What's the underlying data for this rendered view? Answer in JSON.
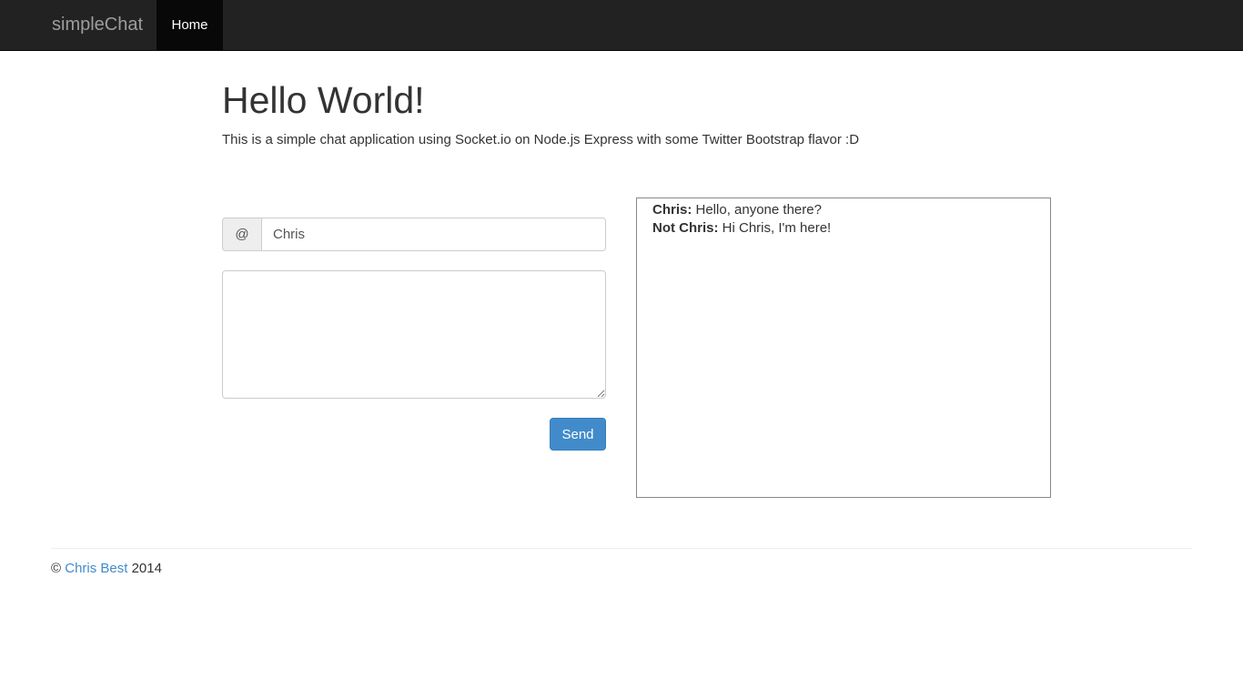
{
  "navbar": {
    "brand": "simpleChat",
    "items": [
      {
        "label": "Home",
        "active": true
      }
    ],
    "bg_color": "#222222"
  },
  "header": {
    "title": "Hello World!",
    "subtitle": "This is a simple chat application using Socket.io on Node.js Express with some Twitter Bootstrap flavor :D"
  },
  "form": {
    "addon_symbol": "@",
    "name_value": "Chris",
    "message_value": "",
    "send_label": "Send",
    "accent_color": "#428bca"
  },
  "chat": {
    "messages": [
      {
        "name": "Chris:",
        "text": " Hello, anyone there?"
      },
      {
        "name": "Not Chris:",
        "text": " Hi Chris, I'm here!"
      }
    ]
  },
  "footer": {
    "copyright_symbol": "©",
    "author": "Chris Best",
    "year": "2014"
  }
}
